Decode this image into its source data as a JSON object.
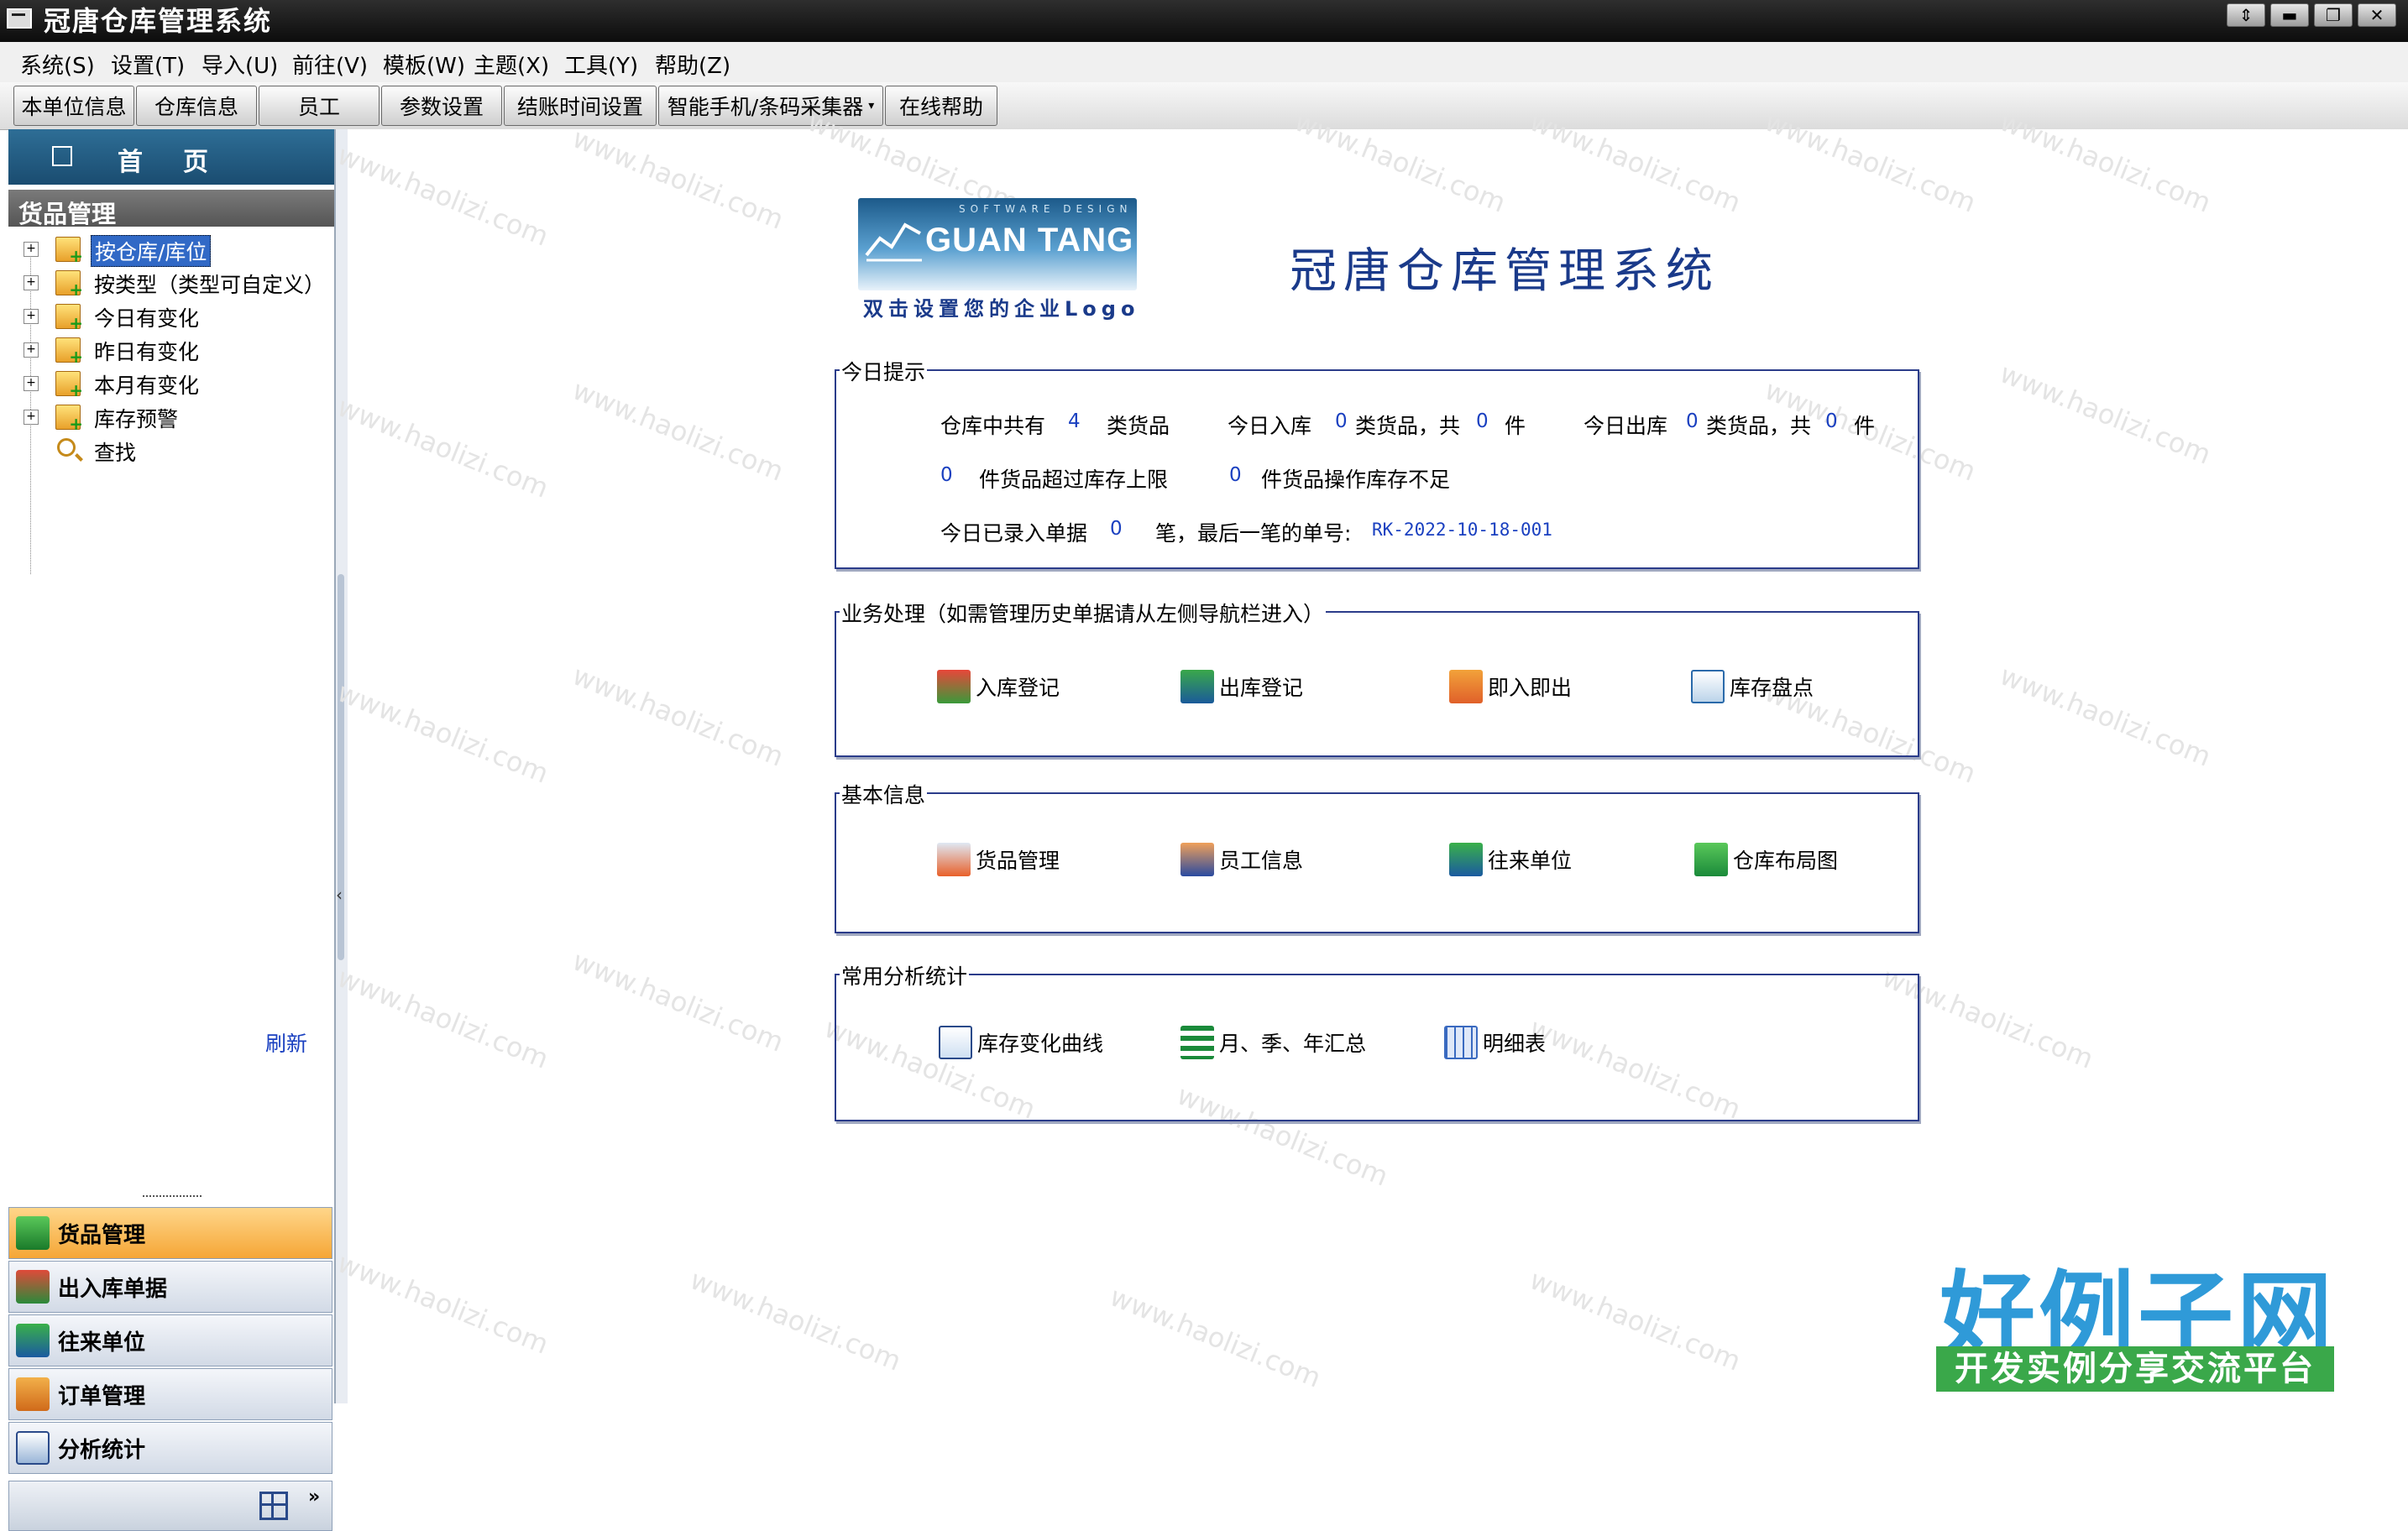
{
  "window": {
    "title": "冠唐仓库管理系统"
  },
  "menu": [
    "系统(S)",
    "设置(T)",
    "导入(U)",
    "前往(V)",
    "模板(W)",
    "主题(X)",
    "工具(Y)",
    "帮助(Z)"
  ],
  "toolbar": [
    "本单位信息",
    "仓库信息",
    "员工",
    "参数设置",
    "结账时间设置",
    "智能手机/条码采集器",
    "在线帮助"
  ],
  "sidebar": {
    "home": "首页",
    "section": "货品管理",
    "tree": [
      "按仓库/库位",
      "按类型（类型可自定义）",
      "今日有变化",
      "昨日有变化",
      "本月有变化",
      "库存预警",
      "查找"
    ],
    "refresh": "刷新",
    "nav": [
      "货品管理",
      "出入库单据",
      "往来单位",
      "订单管理",
      "分析统计"
    ]
  },
  "logo": {
    "brand": "GUAN TANG",
    "tag": "SOFTWARE DESIGN",
    "caption": "双击设置您的企业Logo"
  },
  "app_title": "冠唐仓库管理系统",
  "today": {
    "legend": "今日提示",
    "l1a": "仓库中共有",
    "goods_count": "4",
    "l1b": "类货品",
    "in_a": "今日入库",
    "in_kinds": "0",
    "in_b": "类货品，共",
    "in_items": "0",
    "in_c": "件",
    "out_a": "今日出库",
    "out_kinds": "0",
    "out_b": "类货品，共",
    "out_items": "0",
    "out_c": "件",
    "over_num": "0",
    "over_txt": "件货品超过库存上限",
    "short_num": "0",
    "short_txt": "件货品操作库存不足",
    "bills_a": "今日已录入单据",
    "bills_num": "0",
    "bills_b": "笔，最后一笔的单号:",
    "last_no": "RK-2022-10-18-001"
  },
  "business": {
    "legend": "业务处理（如需管理历史单据请从左侧导航栏进入）",
    "actions": [
      "入库登记",
      "出库登记",
      "即入即出",
      "库存盘点"
    ]
  },
  "basic": {
    "legend": "基本信息",
    "actions": [
      "货品管理",
      "员工信息",
      "往来单位",
      "仓库布局图"
    ]
  },
  "stats": {
    "legend": "常用分析统计",
    "actions": [
      "库存变化曲线",
      "月、季、年汇总",
      "明细表"
    ]
  },
  "watermark": {
    "site": "www.haolizi.com",
    "big": "好例子网",
    "slogan": "开发实例分享交流平台"
  }
}
